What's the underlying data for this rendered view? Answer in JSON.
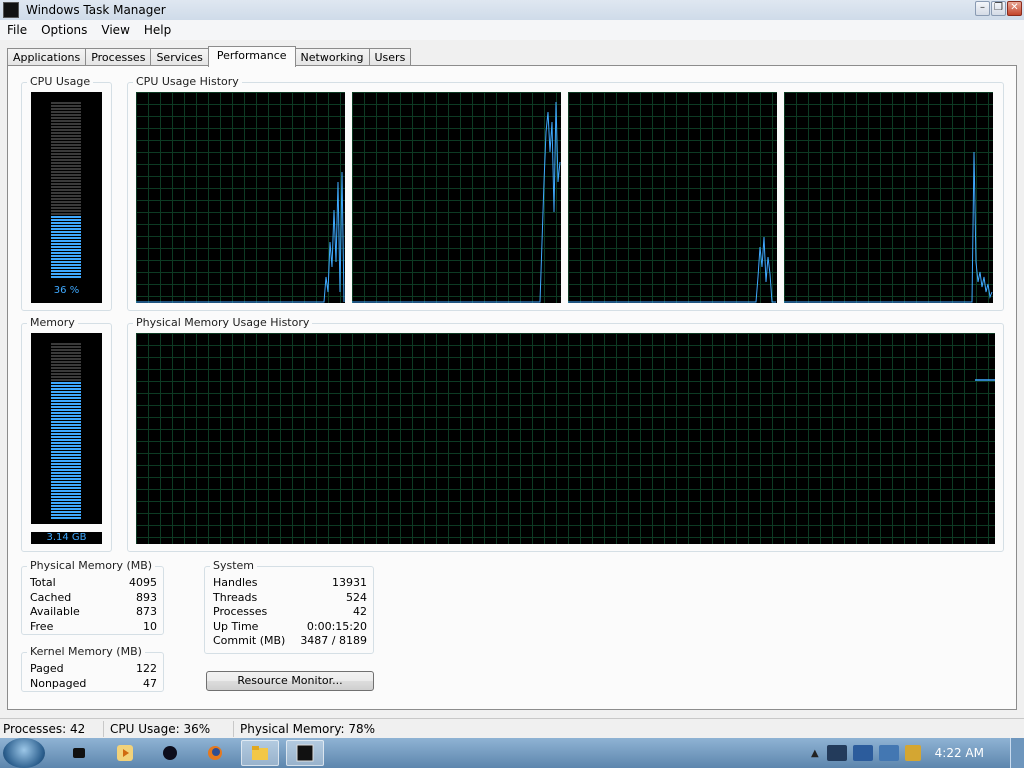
{
  "window": {
    "title": "Windows Task Manager"
  },
  "menu": [
    "File",
    "Options",
    "View",
    "Help"
  ],
  "tabs": [
    "Applications",
    "Processes",
    "Services",
    "Performance",
    "Networking",
    "Users"
  ],
  "active_tab": "Performance",
  "cpu": {
    "group_label": "CPU Usage",
    "value": "36 %",
    "fraction": 0.36,
    "history_label": "CPU Usage History"
  },
  "memory": {
    "group_label": "Memory",
    "value": "3.14 GB",
    "fraction": 0.78,
    "history_label": "Physical Memory Usage History"
  },
  "physical_memory": {
    "label": "Physical Memory (MB)",
    "rows": [
      {
        "name": "Total",
        "value": "4095"
      },
      {
        "name": "Cached",
        "value": "893"
      },
      {
        "name": "Available",
        "value": "873"
      },
      {
        "name": "Free",
        "value": "10"
      }
    ]
  },
  "kernel_memory": {
    "label": "Kernel Memory (MB)",
    "rows": [
      {
        "name": "Paged",
        "value": "122"
      },
      {
        "name": "Nonpaged",
        "value": "47"
      }
    ]
  },
  "system": {
    "label": "System",
    "rows": [
      {
        "name": "Handles",
        "value": "13931"
      },
      {
        "name": "Threads",
        "value": "524"
      },
      {
        "name": "Processes",
        "value": "42"
      },
      {
        "name": "Up Time",
        "value": "0:00:15:20"
      },
      {
        "name": "Commit (MB)",
        "value": "3487 / 8189"
      }
    ]
  },
  "resource_button": "Resource Monitor...",
  "status": {
    "processes": "Processes: 42",
    "cpu": "CPU Usage: 36%",
    "memory": "Physical Memory: 78%"
  },
  "clock": "4:22 AM",
  "colors": {
    "graph_line": "#3fa9ff",
    "grid": "#0d3a23",
    "graph_bg": "#000000"
  },
  "taskbar_icons": [
    "media-player-icon",
    "windows-media-icon",
    "explorer-icon",
    "firefox-icon",
    "folder-icon",
    "task-manager-icon"
  ]
}
